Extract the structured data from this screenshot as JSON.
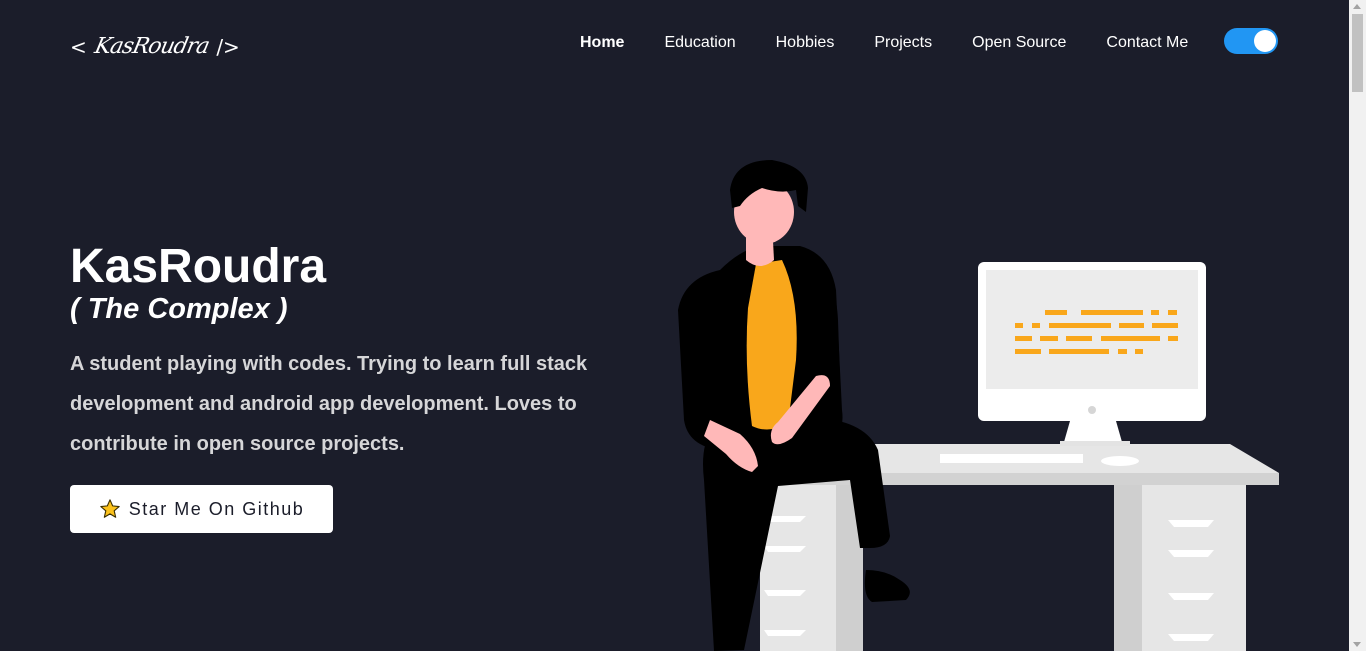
{
  "header": {
    "logo": {
      "open": "<",
      "signature": "KasRoudra",
      "close": "/>"
    },
    "nav": [
      {
        "label": "Home",
        "active": true
      },
      {
        "label": "Education"
      },
      {
        "label": "Hobbies"
      },
      {
        "label": "Projects"
      },
      {
        "label": "Open Source"
      },
      {
        "label": "Contact Me"
      }
    ],
    "theme_toggle": {
      "on": true,
      "color": "#2196f3"
    }
  },
  "hero": {
    "title": "KasRoudra",
    "subtitle": "( The Complex )",
    "description": "A student playing with codes. Trying to learn full stack development and android app development. Loves to contribute in open source projects.",
    "button_label": "Star Me On Github",
    "button_icon": "star-icon"
  },
  "colors": {
    "background": "#1b1d2a",
    "accent": "#f9a71b"
  }
}
